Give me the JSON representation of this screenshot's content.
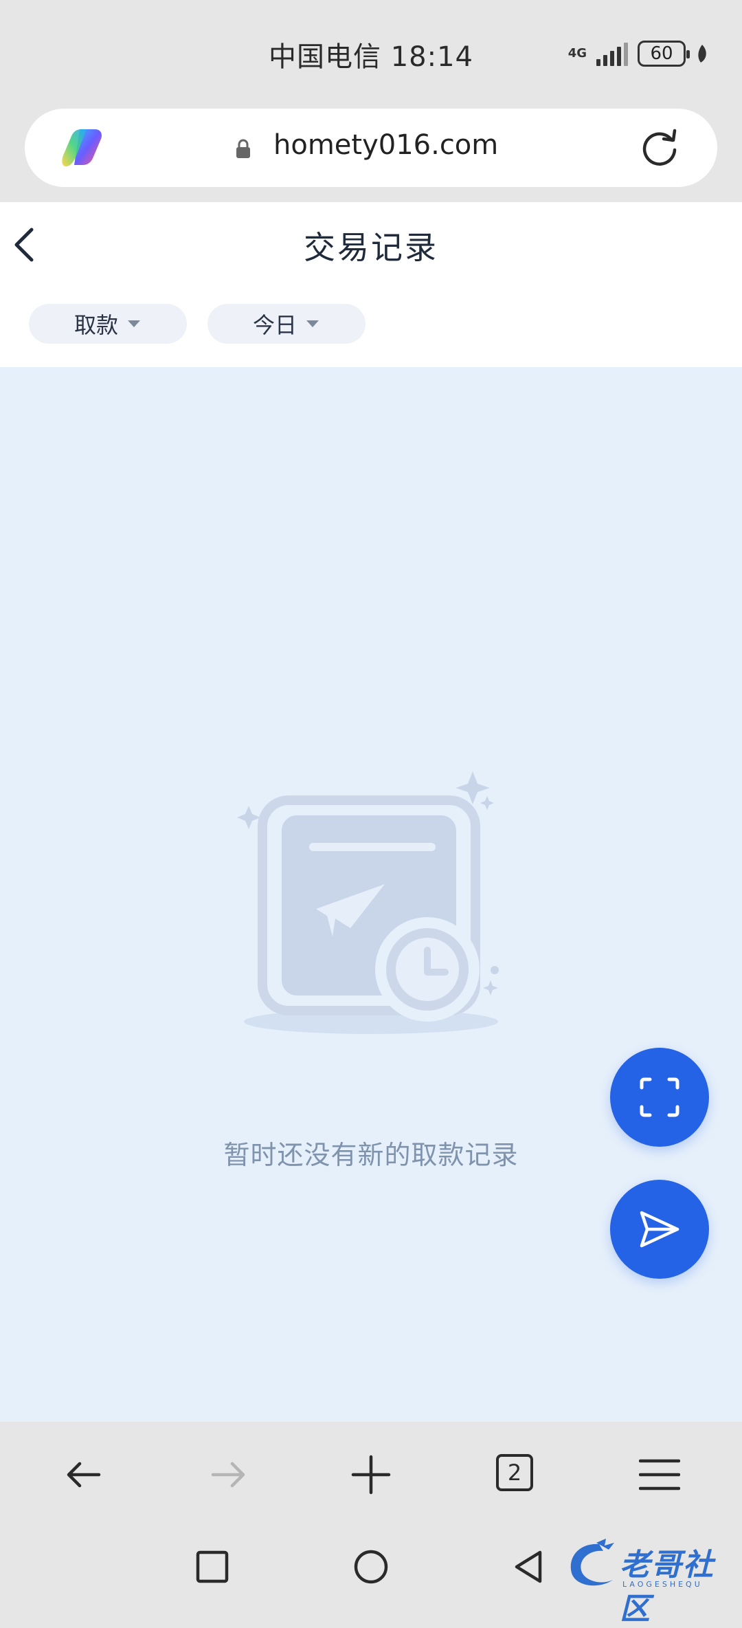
{
  "status_bar": {
    "carrier_time": "中国电信 18:14",
    "network": "4G",
    "battery": "60"
  },
  "browser": {
    "url": "homety016.com",
    "tab_count": "2"
  },
  "page": {
    "title": "交易记录",
    "filters": [
      {
        "label": "取款"
      },
      {
        "label": "今日"
      }
    ],
    "empty_message": "暂时还没有新的取款记录"
  },
  "watermark": {
    "text": "老哥社区",
    "sub": "LAOGESHEQU"
  },
  "colors": {
    "accent": "#2463e6",
    "page_bg": "#e6f0fb",
    "empty_text": "#7f93ad"
  },
  "icons": {
    "app_logo": "copilot-logo-icon",
    "lock": "lock-icon",
    "reload": "reload-icon",
    "back": "chevron-left-icon",
    "caret": "caret-down-icon",
    "fab_scan": "scan-icon",
    "fab_send": "send-icon",
    "browser_back": "arrow-left-icon",
    "browser_forward": "arrow-right-icon",
    "browser_new_tab": "plus-icon",
    "browser_menu": "menu-icon",
    "system_recents": "square-icon",
    "system_home": "circle-icon",
    "system_back": "triangle-back-icon"
  }
}
